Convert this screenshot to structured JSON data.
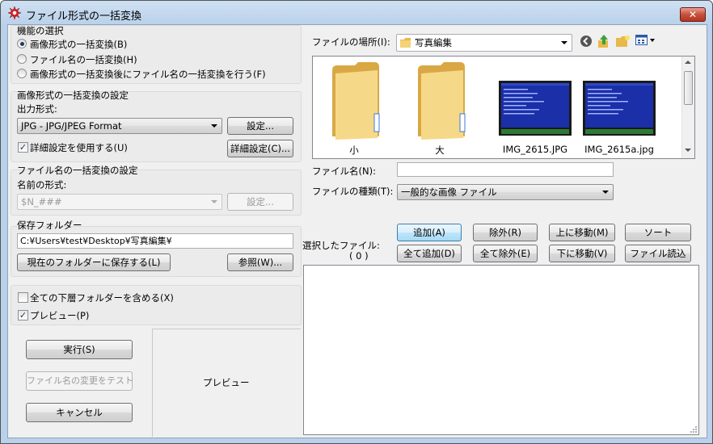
{
  "window": {
    "title": "ファイル形式の一括変換",
    "close_label": "✕"
  },
  "function_group": {
    "title": "機能の選択",
    "options": [
      {
        "label": "画像形式の一括変換(B)",
        "selected": true
      },
      {
        "label": "ファイル名の一括変換(H)",
        "selected": false
      },
      {
        "label": "画像形式の一括変換後にファイル名の一括変換を行う(F)",
        "selected": false
      }
    ]
  },
  "image_format_group": {
    "title": "画像形式の一括変換の設定",
    "output_label": "出力形式:",
    "output_value": "JPG - JPG/JPEG Format",
    "settings_button": "設定...",
    "detail_check_label": "詳細設定を使用する(U)",
    "detail_checked": true,
    "detail_button": "詳細設定(C)..."
  },
  "filename_group": {
    "title": "ファイル名の一括変換の設定",
    "name_label": "名前の形式:",
    "name_value": "$N_###",
    "settings_button": "設定..."
  },
  "save_group": {
    "title": "保存フォルダー",
    "path": "C:¥Users¥test¥Desktop¥写真編集¥",
    "save_current_button": "現在のフォルダーに保存する(L)",
    "browse_button": "参照(W)..."
  },
  "options": {
    "subfolders_label": "全ての下層フォルダーを含める(X)",
    "subfolders_checked": false,
    "preview_label": "プレビュー(P)",
    "preview_checked": true
  },
  "actions": {
    "run_button": "実行(S)",
    "test_button": "ファイル名の変更をテスト",
    "cancel_button": "キャンセル"
  },
  "preview_box": {
    "label": "プレビュー"
  },
  "browser": {
    "location_label": "ファイルの場所(I):",
    "location_value": "写真編集",
    "items": [
      {
        "name": "小",
        "kind": "folder"
      },
      {
        "name": "大",
        "kind": "folder"
      },
      {
        "name": "IMG_2615.JPG",
        "kind": "image"
      },
      {
        "name": "IMG_2615a.jpg",
        "kind": "image"
      }
    ],
    "filename_label": "ファイル名(N):",
    "filename_value": "",
    "filetype_label": "ファイルの種類(T):",
    "filetype_value": "一般的な画像 ファイル"
  },
  "selection": {
    "label": "選択したファイル:",
    "count": "( 0 )",
    "buttons": {
      "add": "追加(A)",
      "remove": "除外(R)",
      "move_up": "上に移動(M)",
      "sort": "ソート",
      "add_all": "全て追加(D)",
      "remove_all": "全て除外(E)",
      "move_down": "下に移動(V)",
      "load_list": "ファイル読込"
    }
  },
  "colors": {
    "accent": "#3c7fb1",
    "folder": "#f0c75e",
    "thumb_screen": "#1b2fa8"
  }
}
